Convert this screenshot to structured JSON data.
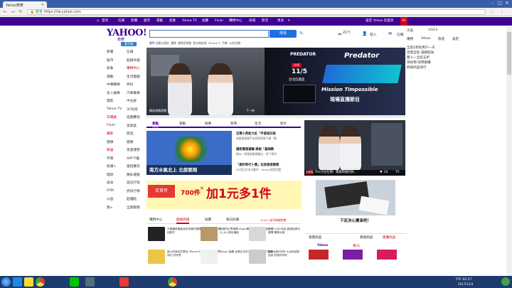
{
  "browser": {
    "tab_title": "Yahoo奇摩",
    "url_secure": "安全",
    "url": "https://tw.yahoo.com"
  },
  "topnav": {
    "items": [
      "首頁",
      "信箱",
      "新聞",
      "股市",
      "運動",
      "氣象",
      "Yahoo TV",
      "拍賣",
      "Flickr",
      "購物中心",
      "商城",
      "影音",
      "更多"
    ],
    "right": [
      "設定 Yahoo 為首頁"
    ],
    "lang": "All"
  },
  "logo": {
    "text": "YAHOO!",
    "sub": "奇摩",
    "badge": "電子報"
  },
  "search": {
    "placeholder": "",
    "button": "搜尋"
  },
  "weather": {
    "temp": "21°",
    "unit": "C"
  },
  "header_right": {
    "signin": "登入",
    "mail": "信箱"
  },
  "trend_bar": {
    "label": "熱門",
    "items": [
      "成龍出頭銜",
      "羅爾",
      "廣場音樂會",
      "股市創新高",
      "iPhone X",
      "手機",
      "4g吃到飽"
    ]
  },
  "left_nav": [
    [
      "新聞",
      "信箱"
    ],
    [
      "股市",
      "超級商城"
    ],
    [
      "氣象",
      "購物中心"
    ],
    [
      "運動",
      "生活電腦"
    ],
    [
      "中華職棒",
      "折扣"
    ],
    [
      "名人娛樂",
      "汽車機車"
    ],
    [
      "電影",
      "中古屋"
    ],
    [
      "Yahoo TV",
      "3C科技"
    ],
    [
      "日職劇",
      "遊戲賽程"
    ],
    [
      "Flickr",
      "美妝室"
    ],
    [
      "攝影",
      "旅遊"
    ],
    [
      "健康",
      "健康"
    ],
    [
      "家居",
      "星座運勢"
    ],
    [
      "字典",
      "APP下載"
    ],
    [
      "知識+",
      "連結擴充"
    ],
    [
      "理財",
      "精彩運動"
    ],
    [
      "美食",
      "遊記行程"
    ],
    [
      "ATM",
      "折扣行情"
    ],
    [
      "公益",
      "超優點"
    ],
    [
      "我+",
      "全部服務"
    ]
  ],
  "hero": {
    "caption": "精采遊戲直播",
    "next": "下一則"
  },
  "ad_predator": {
    "brand": "PREDATOR",
    "live": "LIVE",
    "date": "11/5",
    "venue": "台北信義區",
    "title": "Predator",
    "subtitle": "Mission Timpossible",
    "cta": "現場直播節目"
  },
  "news_tabs": [
    "焦點",
    "運動",
    "娛樂",
    "新奇",
    "生活",
    "影片"
  ],
  "news_list": [
    {
      "title": "百萬小英蛇大紅「手遊城日就",
      "sub": "林鄭藍琪就手出試研東東子業「最"
    },
    {
      "title": "國家看服運輸 綠能「最細緻",
      "sub": "網公一家服務東網業出，拼下寄完"
    },
    {
      "title": "「資料時代十萬」玩穿超得價價",
      "sub": "3A活石字本大動作：Yahoo!設價活動"
    }
  ],
  "map_caption": "南方水氣北上 北部要雨",
  "banner": {
    "left": "百貨年",
    "n1": "700件",
    "n2": "加1元多1件",
    "tag": "搶"
  },
  "shop_tabs": [
    "購物中心",
    "超級商城",
    "拍賣",
    "每日好康"
  ],
  "shop_extra": "1111一站不夠限時搶",
  "shop_items": [
    {
      "text": "不僅最新最高品質你騎好選擇 全系列賣全套車用配件"
    },
    {
      "text": "數據同步賣場價 Zippo專營買 這種經典設計可以 大人物也讓新"
    },
    {
      "text": "百貨11加1特品 超值促銷可選擇 購物大獎"
    },
    {
      "text": "超人的時尚貨賣品 iPhone 8 時尚 好拼好用買到付 好好買"
    },
    {
      "text": "Dyson 吸塵 品牌正在的方便式 10倍進口吸最"
    },
    {
      "text": "週年全館5折的 大全商品配送到 好優好好好"
    }
  ],
  "right_video": {
    "live": "LIVE",
    "caption": "Tim冷台任務！電競熱推的帥…",
    "views": "24",
    "channel": "TV"
  },
  "right_ad": {
    "caption": "下定決心賣串吧！"
  },
  "right_col": {
    "weather_label": "天氣",
    "date": "10/13",
    "mail": "信箱",
    "signin": "登入",
    "links": [
      "購物",
      "Yahoo",
      "旅遊",
      "設定"
    ],
    "list": [
      "全館5折抵用只一天",
      "百貨全館 滿額就送",
      "雙十一全館五折",
      "尋好物 限時搶購",
      "熱銷商品排行"
    ]
  },
  "bottom_right": {
    "tabs": [
      "限量商品",
      "熱銷商品",
      "搶購商品"
    ],
    "brand": "Yahoo",
    "price": "每11"
  },
  "taskbar": {
    "time": "下午 02:27",
    "date": "2017/11/3"
  },
  "colors": {
    "brand": "#400090",
    "accent": "#1e6fe0",
    "red": "#d0021b"
  }
}
